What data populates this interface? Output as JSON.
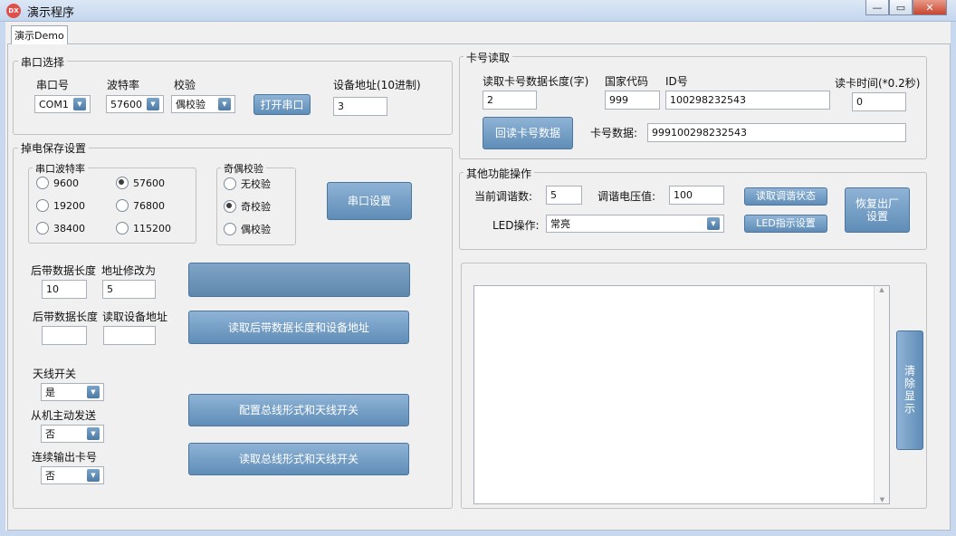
{
  "window": {
    "title": "演示程序",
    "icon_text": "DX",
    "tab": "演示Demo",
    "controls": [
      "—",
      "▭",
      "✕"
    ]
  },
  "serial_select": {
    "title": "串口选择",
    "port_label": "串口号",
    "port_value": "COM1",
    "baud_label": "波特率",
    "baud_value": "57600",
    "parity_label": "校验",
    "parity_value": "偶校验",
    "open_button": "打开串口",
    "addr_label": "设备地址(10进制)",
    "addr_value": "3"
  },
  "power_save": {
    "title": "掉电保存设置",
    "baud_group": {
      "title": "串口波特率",
      "options": [
        "9600",
        "57600",
        "19200",
        "76800",
        "38400",
        "115200"
      ],
      "selected": "57600"
    },
    "parity_group": {
      "title": "奇偶校验",
      "options": [
        "无校验",
        "奇校验",
        "偶校验"
      ],
      "selected": "奇校验"
    },
    "serial_settings_button": "串口设置",
    "data_len_label": "后带数据长度",
    "data_len_value": "10",
    "addr_change_label": "地址修改为",
    "addr_change_value": "5",
    "data_len_label2": "后带数据长度",
    "read_addr_label": "读取设备地址",
    "read_button": "读取后带数据长度和设备地址",
    "antenna_label": "天线开关",
    "antenna_value": "是",
    "slave_label": "从机主动发送",
    "slave_value": "否",
    "continuous_label": "连续输出卡号",
    "continuous_value": "否",
    "config_button": "配置总线形式和天线开关",
    "read_bus_button": "读取总线形式和天线开关"
  },
  "card_read": {
    "title": "卡号读取",
    "len_label": "读取卡号数据长度(字)",
    "len_value": "2",
    "country_label": "国家代码",
    "country_value": "999",
    "id_label": "ID号",
    "id_value": "100298232543",
    "time_label": "读卡时间(*0.2秒)",
    "time_value": "0",
    "read_button": "回读卡号数据",
    "card_label": "卡号数据:",
    "card_value": "999100298232543"
  },
  "other": {
    "title": "其他功能操作",
    "level_label": "当前调谐数:",
    "level_value": "5",
    "voltage_label": "调谐电压值:",
    "voltage_value": "100",
    "read_tune_button": "读取调谐状态",
    "led_label": "LED操作:",
    "led_value": "常亮",
    "led_button": "LED指示设置",
    "reset_button": "恢复出厂设置"
  },
  "display": {
    "clear_button": "清除显示",
    "content": ""
  }
}
